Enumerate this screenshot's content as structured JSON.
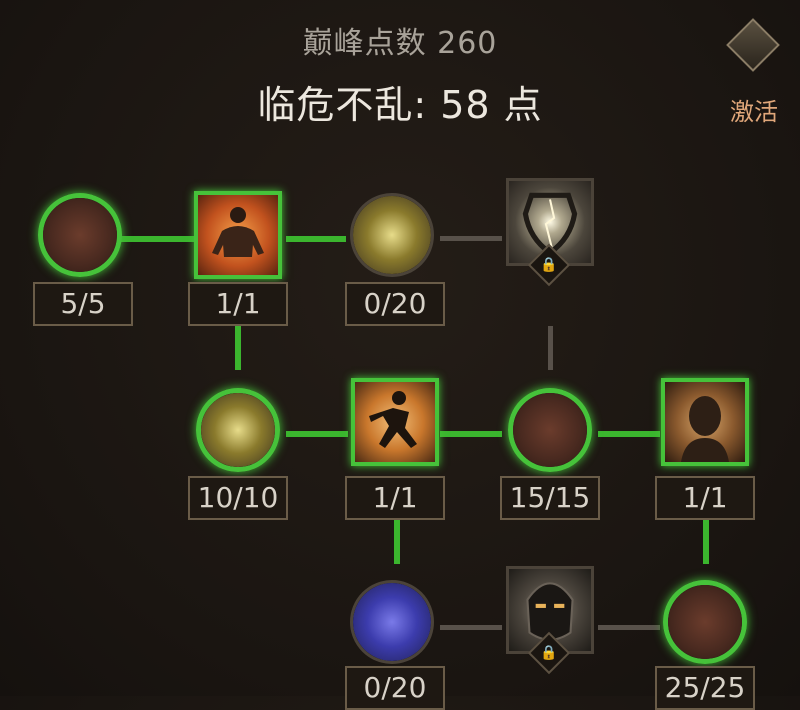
{
  "header": {
    "points_text": "巅峰点数 260",
    "title_text": "临危不乱: 58 点"
  },
  "activate": {
    "label": "激活",
    "icon": "diamond-icon"
  },
  "nodes": {
    "heart1": {
      "counter": "5/5",
      "icon": "heart-shield-icon",
      "state": "active"
    },
    "body1": {
      "counter": "1/1",
      "icon": "power-body-icon",
      "state": "active"
    },
    "shield1": {
      "counter": "0/20",
      "icon": "shield-icon",
      "state": "inactive"
    },
    "cracked": {
      "icon": "cracked-shield-icon",
      "state": "locked"
    },
    "shield2": {
      "counter": "10/10",
      "icon": "shield-icon",
      "state": "active"
    },
    "runner": {
      "counter": "1/1",
      "icon": "running-man-icon",
      "state": "active"
    },
    "heart2": {
      "counter": "15/15",
      "icon": "heart-shield-icon",
      "state": "active"
    },
    "head": {
      "counter": "1/1",
      "icon": "bald-head-icon",
      "state": "active"
    },
    "blue": {
      "counter": "0/20",
      "icon": "blue-shield-icon",
      "state": "inactive"
    },
    "helmet": {
      "icon": "helmet-icon",
      "state": "locked"
    },
    "swords": {
      "counter": "25/25",
      "icon": "crossed-swords-icon",
      "state": "active"
    }
  },
  "colors": {
    "active": "#46c23a",
    "link_green": "#3bb52e",
    "link_dim": "#58514a",
    "accent": "#e0a77a"
  }
}
